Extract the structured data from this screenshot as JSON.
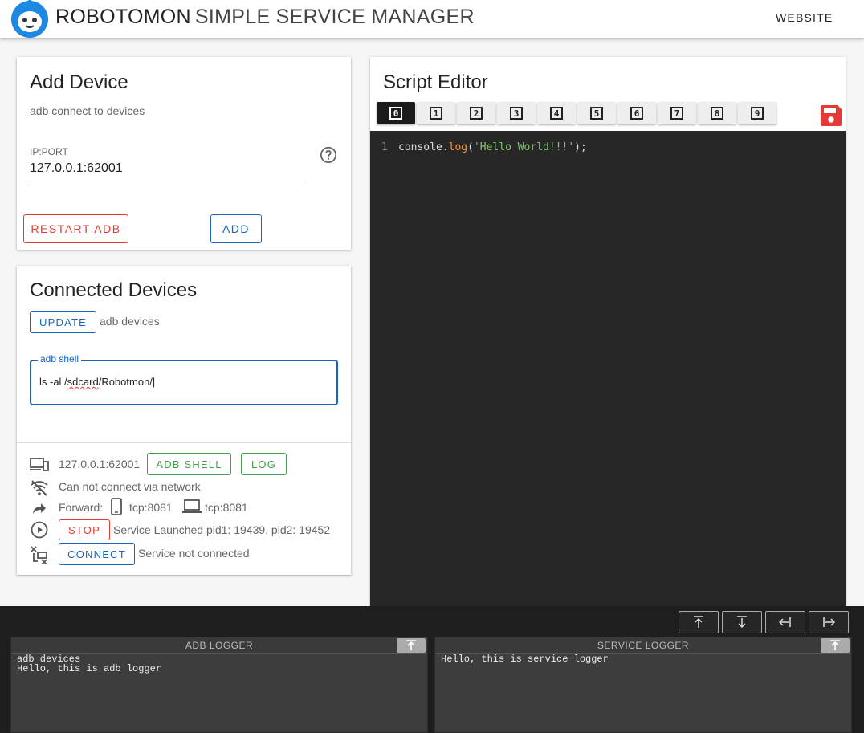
{
  "header": {
    "brand_main": "ROBOTOMON",
    "brand_sub": "SIMPLE SERVICE MANAGER",
    "website_link": "WEBSITE"
  },
  "add_device": {
    "title": "Add Device",
    "subtitle": "adb connect to devices",
    "ip_label": "IP:PORT",
    "ip_value": "127.0.0.1:62001",
    "restart_label": "RESTART ADB",
    "add_label": "ADD"
  },
  "connected_devices": {
    "title": "Connected Devices",
    "update_label": "UPDATE",
    "update_hint": "adb devices",
    "shell_legend": "adb shell",
    "shell_value_prefix": "ls -al /",
    "shell_value_misspelled": "sdcard",
    "shell_value_suffix": "/Robotmon/",
    "device_ip": "127.0.0.1:62001",
    "adb_shell_label": "ADB SHELL",
    "log_label": "LOG",
    "network_status": "Can not connect via network",
    "forward_label": "Forward:",
    "forward_phone": "tcp:8081",
    "forward_pc": "tcp:8081",
    "stop_label": "STOP",
    "service_status": "Service Launched pid1: 19439, pid2: 19452",
    "connect_label": "CONNECT",
    "connection_status": "Service not connected"
  },
  "script_editor": {
    "title": "Script Editor",
    "tabs": [
      "0",
      "1",
      "2",
      "3",
      "4",
      "5",
      "6",
      "7",
      "8",
      "9"
    ],
    "active_tab": 0,
    "line_number": "1",
    "code": {
      "obj": "console.",
      "fn": "log",
      "open": "(",
      "str": "'Hello World!!!'",
      "close": ");"
    }
  },
  "loggers": {
    "adb": {
      "title": "ADB LOGGER",
      "lines": [
        "adb devices",
        "Hello, this is adb logger"
      ]
    },
    "service": {
      "title": "SERVICE LOGGER",
      "lines": [
        "Hello, this is service logger"
      ]
    }
  },
  "colors": {
    "primary": "#1565c0",
    "danger": "#e53935",
    "success": "#43a047",
    "editor_bg": "#272727"
  }
}
